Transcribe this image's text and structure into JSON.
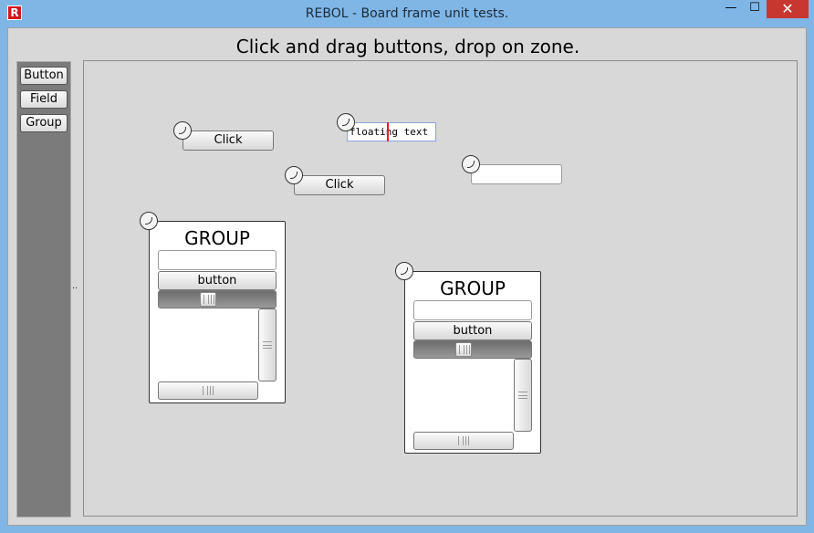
{
  "window": {
    "title": "REBOL - Board frame unit tests.",
    "app_icon": "R",
    "minimize_glyph": "—",
    "maximize_glyph": "☐",
    "close_glyph": "✕"
  },
  "heading": "Click and drag buttons, drop on zone.",
  "toolbox": {
    "items": [
      "Button",
      "Field",
      "Group"
    ]
  },
  "splitter": "··",
  "zone": {
    "buttons": [
      {
        "label": "Click"
      },
      {
        "label": "Click"
      }
    ],
    "floating_field": {
      "value": "floating text"
    },
    "empty_field": {
      "value": ""
    },
    "groups": [
      {
        "title": "GROUP",
        "button_label": "button",
        "field_value": ""
      },
      {
        "title": "GROUP",
        "button_label": "button",
        "field_value": ""
      }
    ]
  }
}
